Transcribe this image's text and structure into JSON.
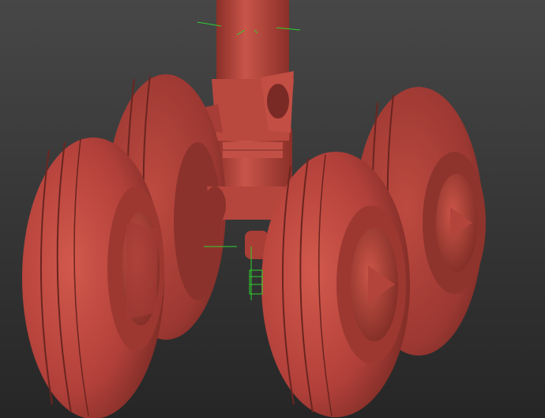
{
  "viewport": {
    "name": "3d-viewport",
    "background_top": "#4a4a4a",
    "background_bottom": "#262626",
    "model_color": "#c0473b",
    "model_shadow": "#7a2a22",
    "model_highlight": "#d86b5d",
    "gizmo_color": "#2fd12f"
  },
  "scene": {
    "object": "landing-gear-model",
    "wheels": [
      {
        "id": "front-left"
      },
      {
        "id": "rear-left"
      },
      {
        "id": "front-right"
      },
      {
        "id": "rear-right"
      }
    ]
  }
}
